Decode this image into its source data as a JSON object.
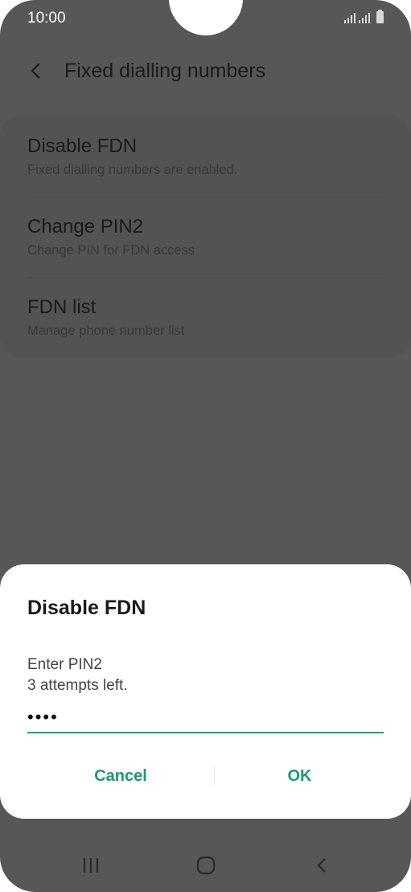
{
  "status_bar": {
    "time": "10:00"
  },
  "header": {
    "title": "Fixed dialling numbers"
  },
  "settings": {
    "items": [
      {
        "title": "Disable FDN",
        "subtitle": "Fixed dialling numbers are enabled."
      },
      {
        "title": "Change PIN2",
        "subtitle": "Change PIN for FDN access"
      },
      {
        "title": "FDN list",
        "subtitle": "Manage phone number list"
      }
    ]
  },
  "dialog": {
    "title": "Disable FDN",
    "message_line1": "Enter PIN2",
    "message_line2": "3 attempts left.",
    "pin_value": "••••",
    "cancel_label": "Cancel",
    "ok_label": "OK"
  },
  "colors": {
    "accent": "#1a9b6e",
    "scrim": "#575757"
  }
}
